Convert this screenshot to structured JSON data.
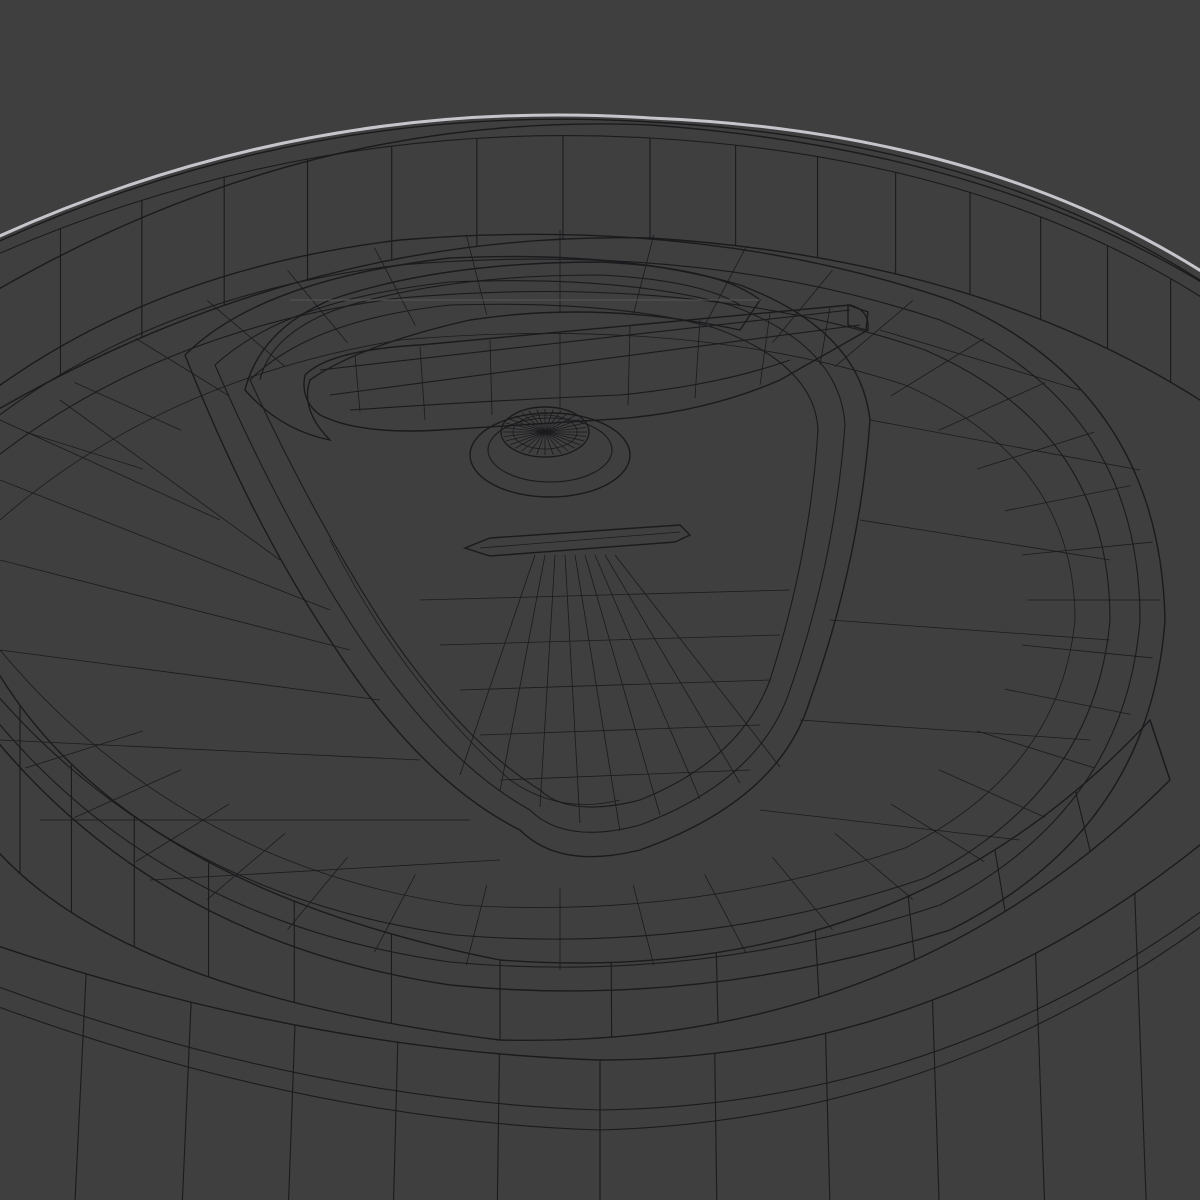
{
  "viewport": {
    "background_color": "#3f3f3f",
    "mode": "wireframe-over-solid",
    "wire_color": "#1b1b1e",
    "surface_color": "#c9c9d1"
  },
  "model": {
    "subject": "can-lid-with-pull-tab"
  }
}
